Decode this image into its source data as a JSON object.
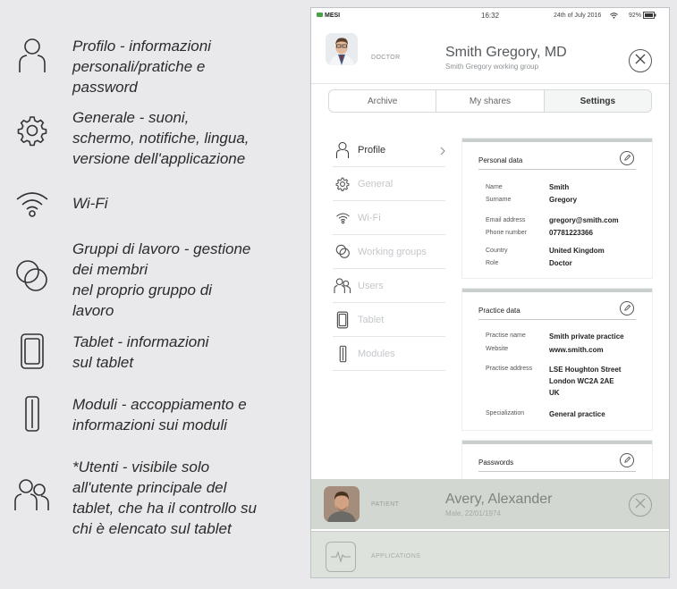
{
  "legend": [
    {
      "icon": "person-icon",
      "lines": [
        "Profilo - informazioni",
        "personali/pratiche e",
        "password"
      ]
    },
    {
      "icon": "gear-icon",
      "lines": [
        "Generale - suoni,",
        "schermo, notifiche, lingua,",
        "versione dell'applicazione"
      ]
    },
    {
      "icon": "wifi-icon",
      "lines": [
        "Wi-Fi"
      ]
    },
    {
      "icon": "working-groups-icon",
      "lines": [
        "Gruppi di lavoro - gestione",
        "dei membri",
        "nel proprio gruppo di",
        "lavoro"
      ]
    },
    {
      "icon": "tablet-icon",
      "lines": [
        "Tablet - informazioni",
        "sul tablet"
      ]
    },
    {
      "icon": "module-icon",
      "lines": [
        "Moduli - accoppiamento e",
        "informazioni sui moduli"
      ]
    },
    {
      "icon": "users-icon",
      "lines": [
        "*Utenti - visibile solo",
        "all'utente principale del",
        "tablet, che ha il controllo su",
        "chi è elencato sul tablet"
      ]
    }
  ],
  "status": {
    "carrier": "MESI",
    "time": "16:32",
    "date": "24th of July 2016",
    "battery": "92%"
  },
  "doctor": {
    "role": "DOCTOR",
    "name": "Smith Gregory, MD",
    "group": "Smith Gregory working group"
  },
  "tabs": [
    "Archive",
    "My shares",
    "Settings"
  ],
  "menu": [
    {
      "label": "Profile",
      "icon": "person-icon",
      "active": true
    },
    {
      "label": "General",
      "icon": "gear-icon",
      "active": false
    },
    {
      "label": "Wi-Fi",
      "icon": "wifi-icon",
      "active": false
    },
    {
      "label": "Working groups",
      "icon": "working-groups-icon",
      "active": false
    },
    {
      "label": "Users",
      "icon": "users-icon",
      "active": false
    },
    {
      "label": "Tablet",
      "icon": "tablet-icon",
      "active": false
    },
    {
      "label": "Modules",
      "icon": "module-icon",
      "active": false
    }
  ],
  "personal": {
    "title": "Personal data",
    "rows": [
      {
        "label": "Name",
        "value": "Smith"
      },
      {
        "label": "Surname",
        "value": "Gregory"
      },
      {
        "label": "Email address",
        "value": "gregory@smith.com"
      },
      {
        "label": "Phone number",
        "value": "07781223366"
      },
      {
        "label": "Country",
        "value": "United Kingdom"
      },
      {
        "label": "Role",
        "value": "Doctor"
      }
    ]
  },
  "practice": {
    "title": "Practice data",
    "rows": [
      {
        "label": "Practise name",
        "value": "Smith private practice"
      },
      {
        "label": "Website",
        "value": "www.smith.com"
      },
      {
        "label": "Practise address",
        "value": "LSE Houghton Street\nLondon WC2A 2AE\nUK"
      },
      {
        "label": "Specialization",
        "value": "General practice"
      }
    ]
  },
  "passwords": {
    "title": "Passwords"
  },
  "patient": {
    "role": "PATIENT",
    "name": "Avery, Alexander",
    "info": "Male, 22/01/1974"
  },
  "apps": {
    "label": "APPLICATIONS"
  }
}
